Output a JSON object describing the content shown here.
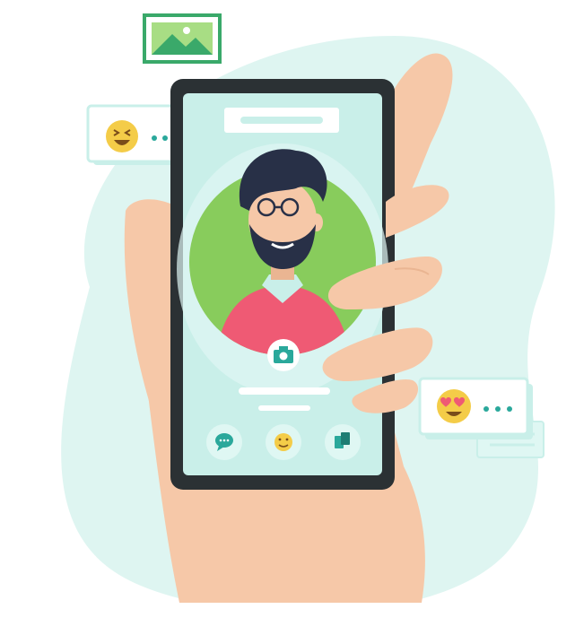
{
  "illustration": {
    "subject": "hand-holding-phone-profile",
    "colors": {
      "blob": "#def5f1",
      "skin": "#f6c8a8",
      "skin_shadow": "#eab592",
      "phone_frame": "#2b3134",
      "screen": "#c9efe9",
      "screen_light": "#dff7f3",
      "accent": "#2aa89b",
      "avatar_bg": "#88cc5c",
      "shirt": "#ef5a74",
      "collar": "#c9efe9",
      "hair": "#283047",
      "emoji": "#f4cc48",
      "heart": "#ef5a74",
      "picture_frame": "#3aa96a",
      "picture_fill": "#a8dd84"
    },
    "icons": {
      "picture": "image-icon",
      "camera": "camera-icon",
      "chat": "chat-bubble-icon",
      "emoji": "smiley-icon",
      "cards": "copy-icon",
      "laugh": "laughing-emoji-icon",
      "love": "heart-eyes-emoji-icon"
    }
  }
}
